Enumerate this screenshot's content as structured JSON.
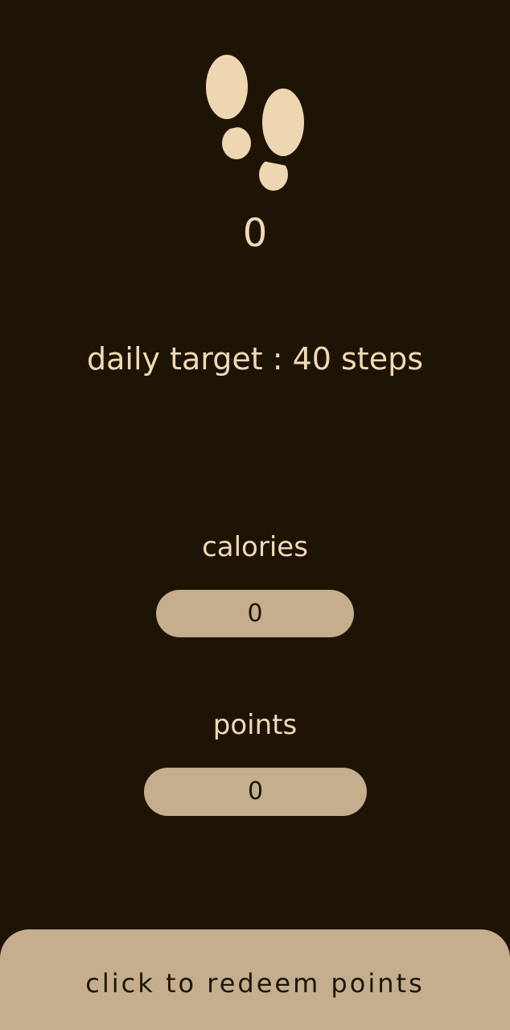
{
  "header": {
    "icon": "footprints-icon",
    "steps_count": "0",
    "daily_target": "daily target : 40 steps"
  },
  "stats": {
    "calories_label": "calories",
    "calories_value": "0",
    "points_label": "points",
    "points_value": "0"
  },
  "actions": {
    "redeem_label": "click to redeem points"
  },
  "colors": {
    "background": "#1e1406",
    "text": "#f0d9b5",
    "pill": "#c4ae8e"
  }
}
